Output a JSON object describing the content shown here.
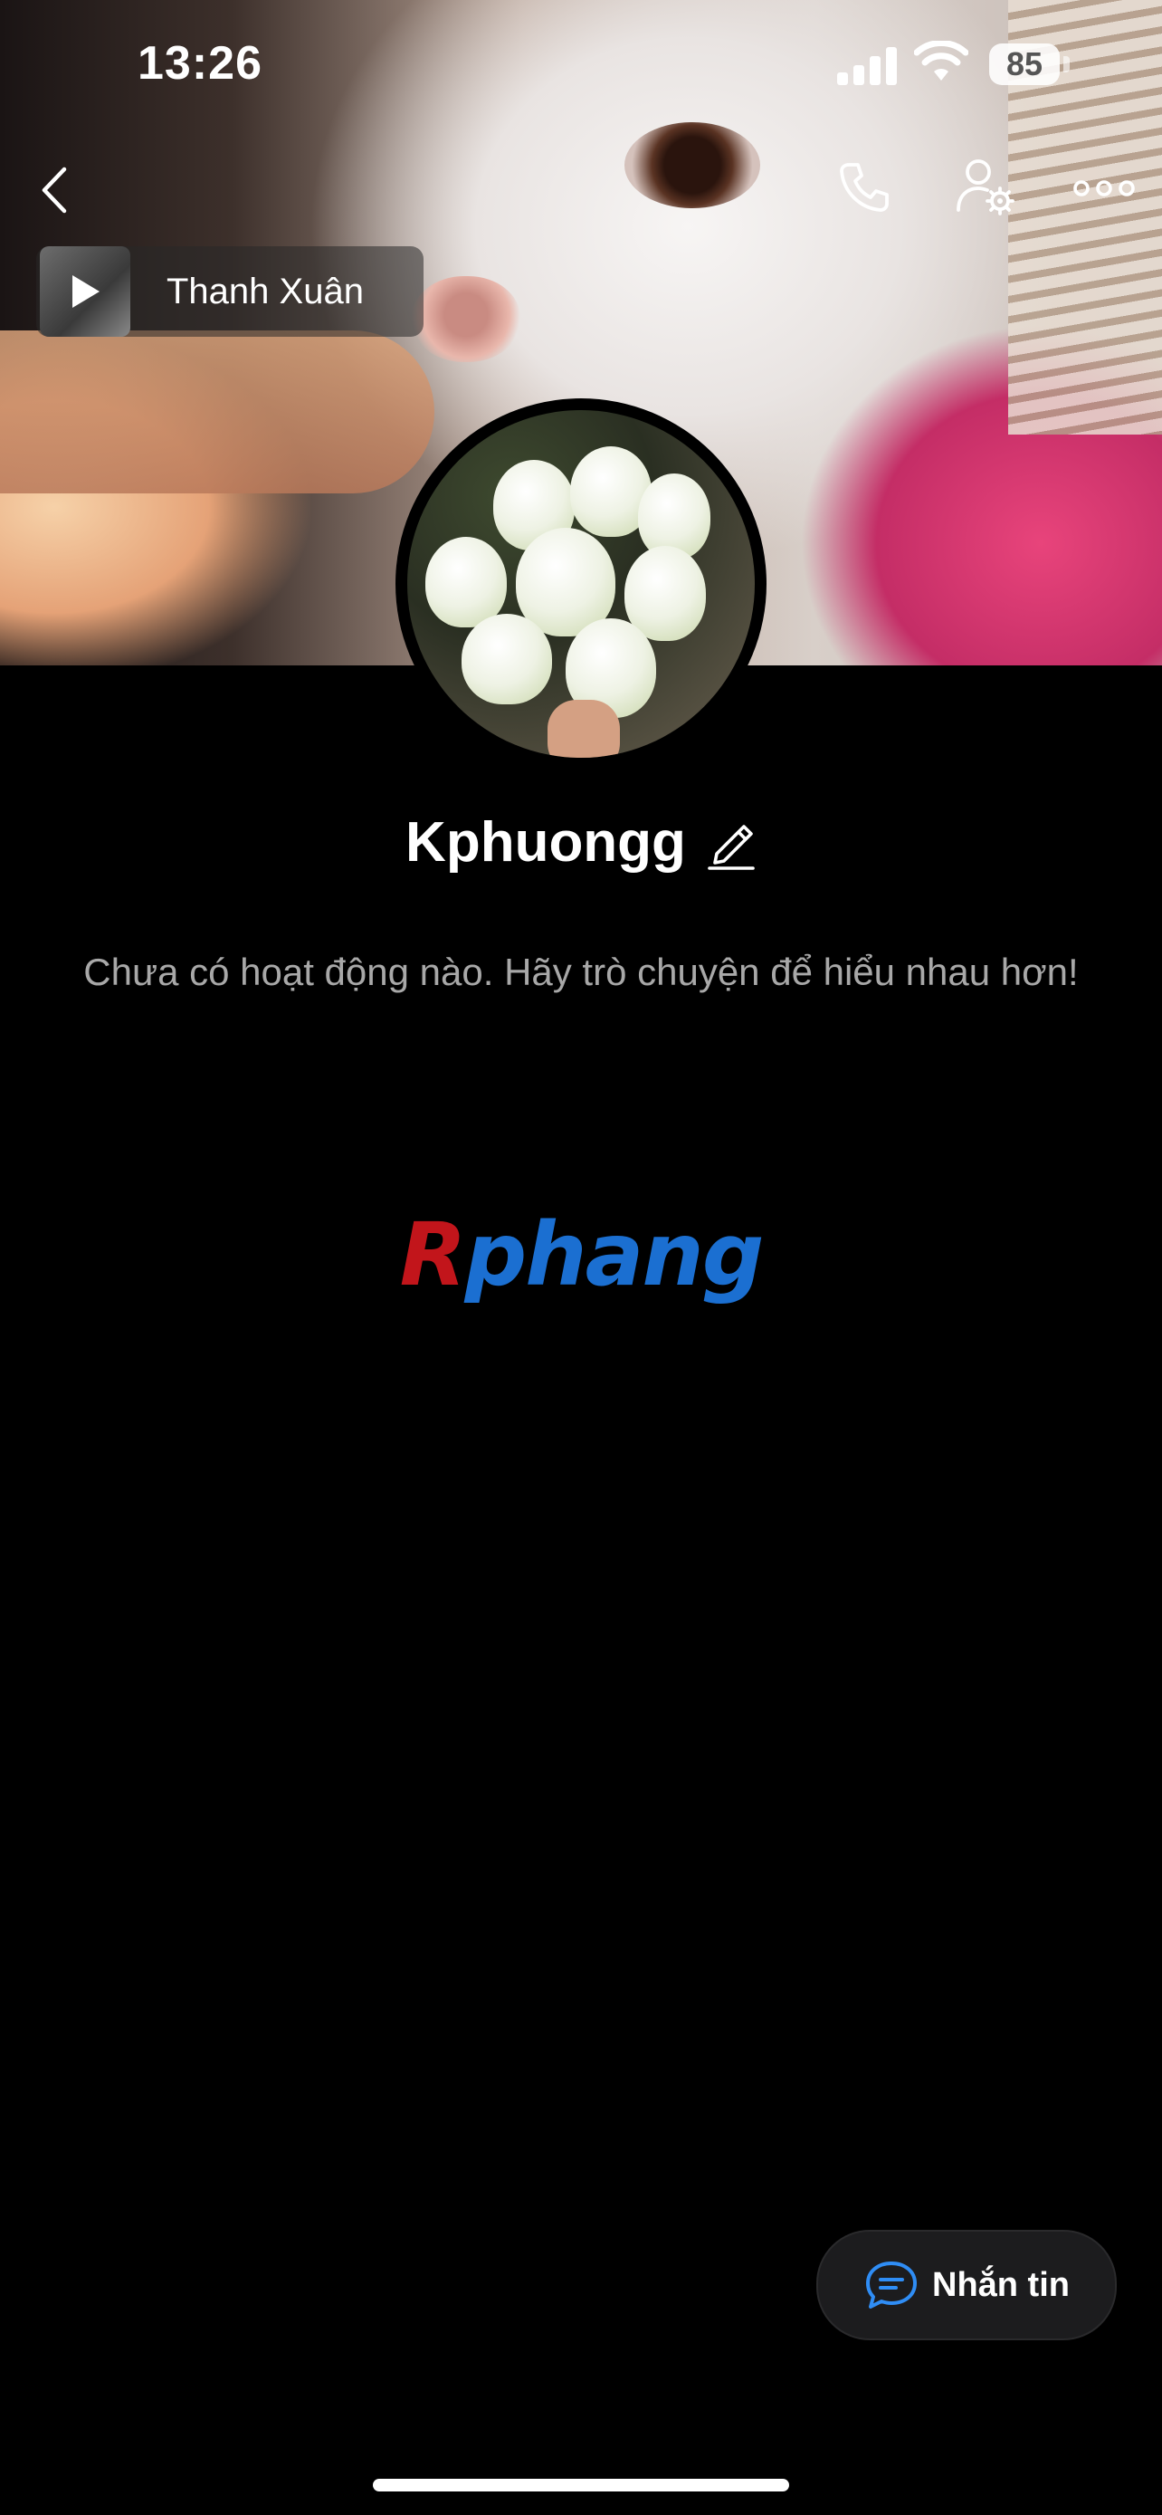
{
  "status_bar": {
    "time": "13:26",
    "battery": "85"
  },
  "header": {
    "back_icon": "chevron-left-icon",
    "call_icon": "phone-icon",
    "settings_icon": "user-gear-icon",
    "more_icon": "more-icon"
  },
  "music": {
    "title": "Thanh Xuân",
    "icon": "play-icon"
  },
  "profile": {
    "name": "Kphuongg",
    "edit_icon": "pencil-icon",
    "empty_message": "Chưa có hoạt động nào. Hãy trò chuyện để hiểu nhau hơn!"
  },
  "watermark": {
    "first": "R",
    "rest": "phang"
  },
  "message_button": {
    "label": "Nhắn tin",
    "icon": "chat-bubble-icon",
    "accent": "#2f8df5"
  }
}
